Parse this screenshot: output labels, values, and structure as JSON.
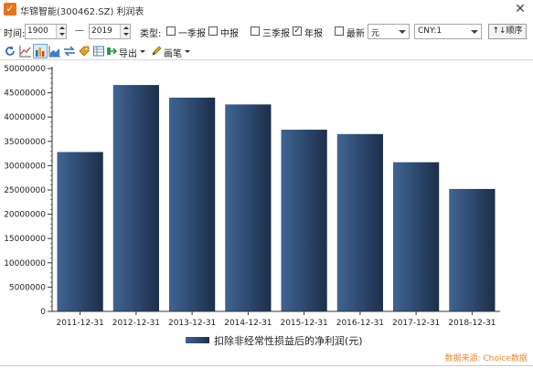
{
  "window": {
    "title": "华锦智能(300462.SZ) 利润表",
    "close_label": "✕"
  },
  "toolbar": {
    "time_label": "时间:",
    "start_year": "1900",
    "dash": "—",
    "end_year": "2019",
    "type_label": "类型:",
    "q1_label": "一季报",
    "interim_label": "中报",
    "q3_label": "三季报",
    "annual_label": "年报",
    "latest_label": "最新",
    "unit_value": "元",
    "currency_value": "CNY:1",
    "sort_label": "↑↓顺序"
  },
  "toolbar2": {
    "export_label": "导出",
    "brush_label": "画笔",
    "icons": [
      "refresh-icon",
      "line-chart-icon",
      "bar-chart-icon",
      "area-chart-icon",
      "swap-icon",
      "tag-icon",
      "table-icon",
      "export-icon",
      "pencil-icon"
    ]
  },
  "chart_data": {
    "type": "bar",
    "categories": [
      "2011-12-31",
      "2012-12-31",
      "2013-12-31",
      "2014-12-31",
      "2015-12-31",
      "2016-12-31",
      "2017-12-31",
      "2018-12-31"
    ],
    "series": [
      {
        "name": "扣除非经常性损益后的净利润(元)",
        "values": [
          32800000,
          46600000,
          44000000,
          42600000,
          37400000,
          36500000,
          30700000,
          25200000
        ]
      }
    ],
    "yticks": [
      0,
      5000000,
      10000000,
      15000000,
      20000000,
      25000000,
      30000000,
      35000000,
      40000000,
      45000000,
      50000000
    ],
    "yticks_text": [
      "0",
      "5000000",
      "10000000",
      "15000000",
      "20000000",
      "25000000",
      "30000000",
      "35000000",
      "40000000",
      "45000000",
      "50000000"
    ],
    "ylim": [
      0,
      50000000
    ],
    "grid": false,
    "legend_position": "bottom-center",
    "colors": {
      "bar_light": "#3f6494",
      "bar_dark": "#1c2f4a",
      "axis": "#333333"
    }
  },
  "footer": {
    "source_label": "数据来源: Choice数据"
  }
}
